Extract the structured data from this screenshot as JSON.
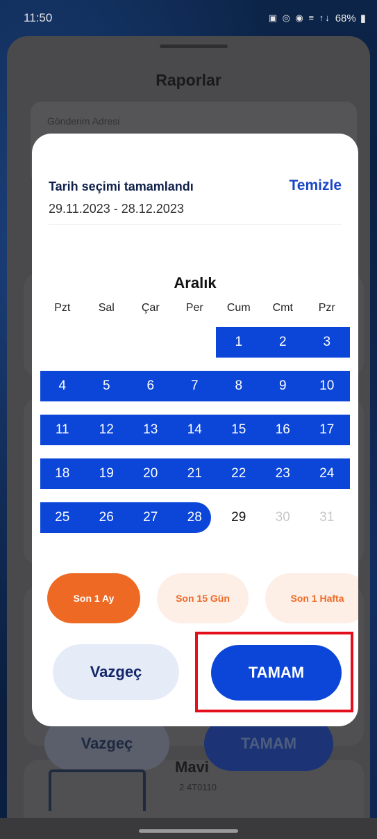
{
  "status_bar": {
    "time": "11:50",
    "icons": "▣ ◎ ◉ ≡ ↑↓",
    "battery": "68%"
  },
  "background": {
    "title": "Raporlar",
    "field_label": "Gönderim Adresi",
    "cancel_label": "Vazgeç",
    "ok_label": "TAMAM",
    "product_name": "Mavi",
    "product_code": "2 4T0110"
  },
  "dialog": {
    "heading": "Tarih seçimi tamamlandı",
    "range": "29.11.2023 - 28.12.2023",
    "clear_label": "Temizle",
    "month": "Aralık",
    "weekdays": [
      "Pzt",
      "Sal",
      "Çar",
      "Per",
      "Cum",
      "Cmt",
      "Pzr"
    ],
    "weeks": [
      [
        "",
        "",
        "",
        "",
        "1",
        "2",
        "3"
      ],
      [
        "4",
        "5",
        "6",
        "7",
        "8",
        "9",
        "10"
      ],
      [
        "11",
        "12",
        "13",
        "14",
        "15",
        "16",
        "17"
      ],
      [
        "18",
        "19",
        "20",
        "21",
        "22",
        "23",
        "24"
      ],
      [
        "25",
        "26",
        "27",
        "28",
        "29",
        "30",
        "31"
      ]
    ],
    "quick_ranges": [
      "Son 1 Ay",
      "Son 15 Gün",
      "Son 1 Hafta"
    ],
    "cancel_label": "Vazgeç",
    "ok_label": "TAMAM"
  },
  "colors": {
    "accent": "#0b46d8",
    "orange": "#ee6a24",
    "highlight": "#e3101b"
  }
}
